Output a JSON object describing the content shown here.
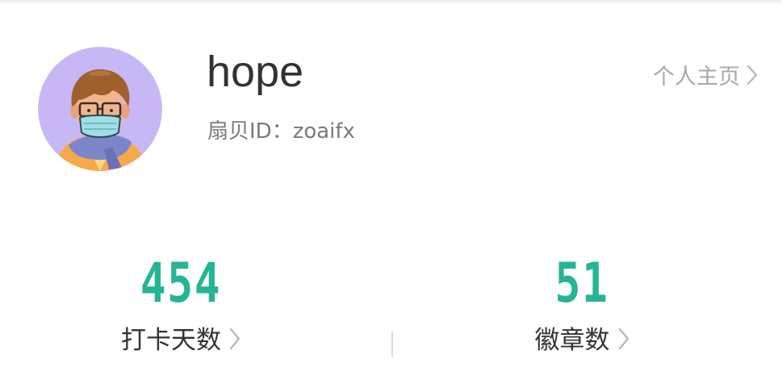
{
  "profile": {
    "username": "hope",
    "user_id": "扇贝ID：zoaifx",
    "avatar_icon": "cartoon-masked-boy-avatar",
    "profile_link_label": "个人主页"
  },
  "stats": [
    {
      "value": "454",
      "label": "打卡天数"
    },
    {
      "value": "51",
      "label": "徽章数"
    }
  ],
  "colors": {
    "accent": "#26b594",
    "avatar_bg": "#c7b8f5",
    "text_primary": "#333333",
    "text_secondary": "#7a7a7a",
    "text_muted": "#a8a8a8"
  },
  "icons": {
    "chevron": "chevron-right-icon"
  }
}
